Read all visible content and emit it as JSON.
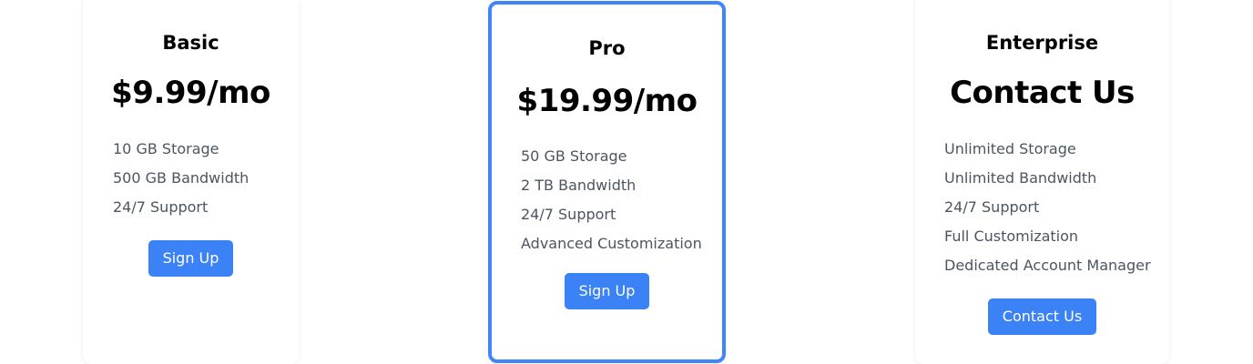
{
  "plans": [
    {
      "name": "Basic",
      "price": "$9.99/mo",
      "features": [
        "10 GB Storage",
        "500 GB Bandwidth",
        "24/7 Support"
      ],
      "button_label": "Sign Up"
    },
    {
      "name": "Pro",
      "price": "$19.99/mo",
      "features": [
        "50 GB Storage",
        "2 TB Bandwidth",
        "24/7 Support",
        "Advanced Customization"
      ],
      "button_label": "Sign Up",
      "highlighted": true
    },
    {
      "name": "Enterprise",
      "price": "Contact Us",
      "features": [
        "Unlimited Storage",
        "Unlimited Bandwidth",
        "24/7 Support",
        "Full Customization",
        "Dedicated Account Manager"
      ],
      "button_label": "Contact Us"
    }
  ],
  "colors": {
    "accent": "#3b82f6",
    "highlight_border": "#4285f4",
    "feature_text": "#4b5563",
    "heading_text": "#000000"
  }
}
